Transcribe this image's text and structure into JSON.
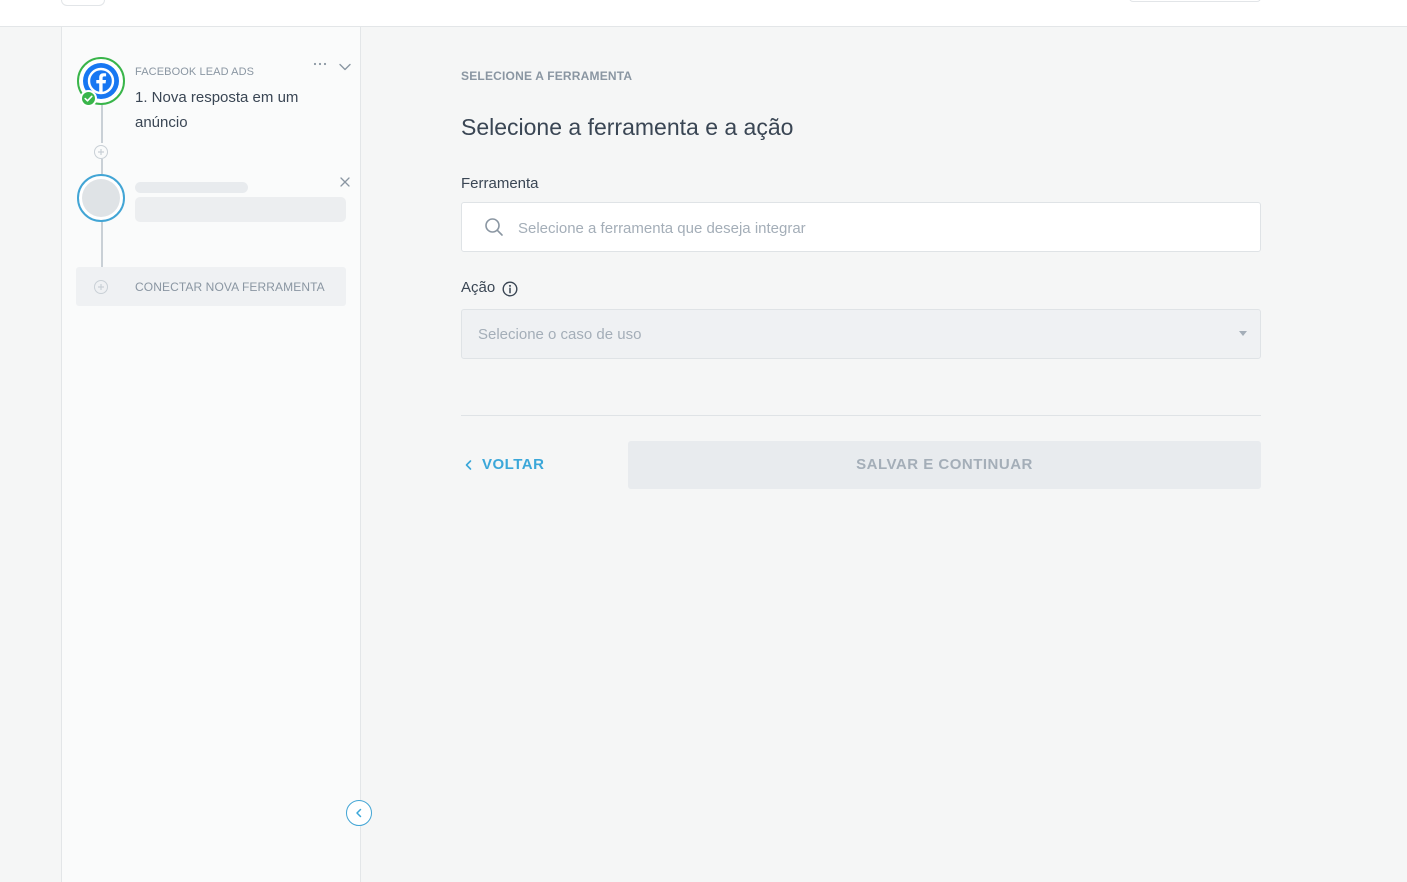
{
  "colors": {
    "accent": "#3ba7d9",
    "success": "#39b54a",
    "facebook": "#1877f2",
    "muted_text": "#8a96a2",
    "body_text": "#3a4654"
  },
  "sidebar": {
    "steps": [
      {
        "app": "FACEBOOK LEAD ADS",
        "title": "1. Nova resposta em um anúncio",
        "icon": "facebook-icon",
        "status": "complete"
      },
      {
        "app": "",
        "title": "",
        "status": "loading"
      }
    ],
    "connect_label": "CONECTAR NOVA FERRAMENTA"
  },
  "main": {
    "section_label": "SELECIONE A FERRAMENTA",
    "title": "Selecione a ferramenta e a ação",
    "tool_label": "Ferramenta",
    "tool_placeholder": "Selecione a ferramenta que deseja integrar",
    "action_label": "Ação",
    "action_placeholder": "Selecione o caso de uso",
    "back_label": "VOLTAR",
    "save_label": "SALVAR E CONTINUAR"
  }
}
